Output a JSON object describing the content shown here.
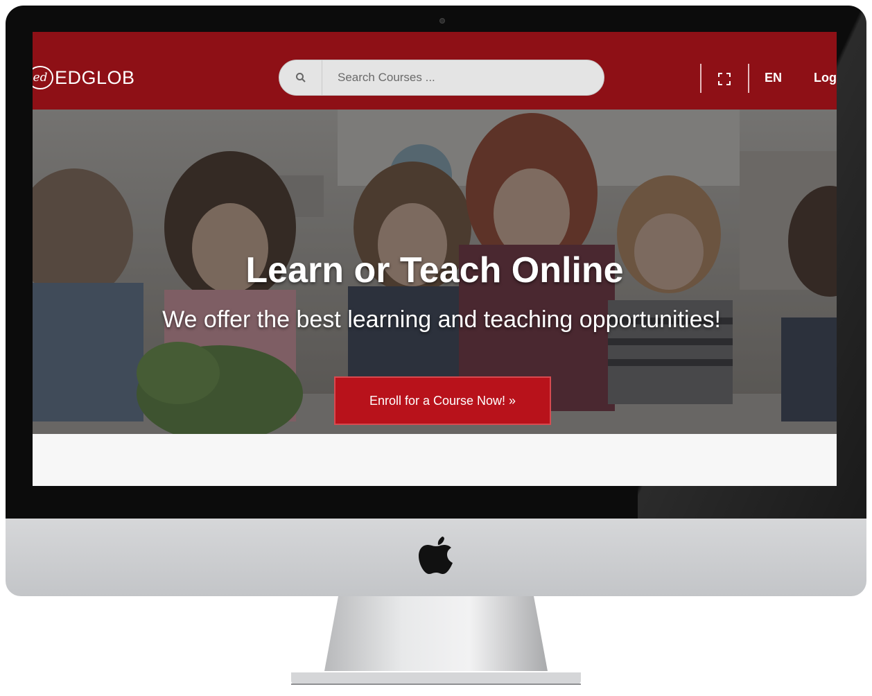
{
  "header": {
    "brand_mark": "ed",
    "brand_name": "EDGLOB",
    "search_placeholder": "Search Courses ...",
    "language": "EN",
    "login_label": "Log"
  },
  "hero": {
    "title": "Learn or Teach Online",
    "subtitle": "We offer the best learning and teaching opportunities!",
    "cta_label": "Enroll for a Course Now! »"
  },
  "icons": {
    "search": "search-icon",
    "fullscreen": "fullscreen-icon",
    "apple": "apple-logo-icon"
  },
  "colors": {
    "brand_red": "#8e1016",
    "cta_red": "#b8121b"
  }
}
